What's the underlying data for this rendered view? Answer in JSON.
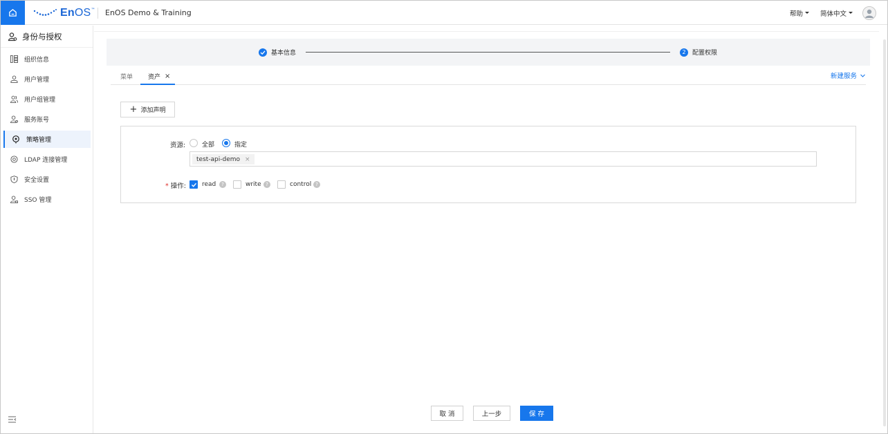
{
  "header": {
    "logo_text_bold": "En",
    "logo_text_light": "OS",
    "logo_tm": "™",
    "org_name": "EnOS Demo & Training",
    "help_label": "帮助",
    "language_label": "简体中文"
  },
  "sidebar": {
    "title": "身份与授权",
    "items": [
      {
        "label": "组织信息",
        "icon": "org-icon"
      },
      {
        "label": "用户管理",
        "icon": "user-icon"
      },
      {
        "label": "用户组管理",
        "icon": "user-group-icon"
      },
      {
        "label": "服务账号",
        "icon": "service-account-icon"
      },
      {
        "label": "策略管理",
        "icon": "policy-icon",
        "active": true
      },
      {
        "label": "LDAP 连接管理",
        "icon": "ldap-icon"
      },
      {
        "label": "安全设置",
        "icon": "shield-icon"
      },
      {
        "label": "SSO 管理",
        "icon": "sso-icon"
      }
    ]
  },
  "steps": [
    {
      "label": "基本信息",
      "state": "done"
    },
    {
      "label": "配置权限",
      "number": "2",
      "state": "current"
    }
  ],
  "tabs": [
    {
      "label": "菜单",
      "active": false
    },
    {
      "label": "资产",
      "active": true,
      "closable": true,
      "close_glyph": "×"
    }
  ],
  "new_service_label": "新建服务",
  "add_statement_label": "添加声明",
  "statement": {
    "resource_label": "资源:",
    "resource_options": [
      {
        "label": "全部",
        "checked": false
      },
      {
        "label": "指定",
        "checked": true
      }
    ],
    "resource_tags": [
      {
        "label": "test-api-demo",
        "remove_glyph": "×"
      }
    ],
    "required_mark": "*",
    "operation_label": "操作:",
    "operations": [
      {
        "label": "read",
        "checked": true
      },
      {
        "label": "write",
        "checked": false
      },
      {
        "label": "control",
        "checked": false
      }
    ],
    "help_glyph": "?"
  },
  "footer": {
    "cancel_label": "取 消",
    "prev_label": "上一步",
    "save_label": "保 存"
  },
  "colors": {
    "primary": "#1777ec",
    "required": "#e0322d"
  }
}
